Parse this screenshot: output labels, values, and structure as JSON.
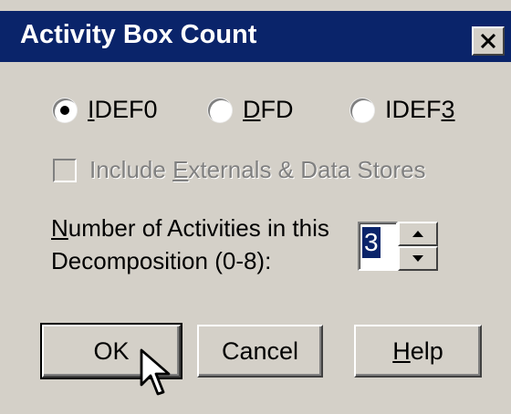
{
  "window": {
    "title": "Activity Box Count"
  },
  "diagram_type": {
    "options": [
      {
        "pre": "",
        "mnemonic": "I",
        "post": "DEF0",
        "selected": true
      },
      {
        "pre": "",
        "mnemonic": "D",
        "post": "FD",
        "selected": false
      },
      {
        "pre": "IDEF",
        "mnemonic": "3",
        "post": "",
        "selected": false
      }
    ]
  },
  "include_externals": {
    "pre": "Include ",
    "mnemonic": "E",
    "post": "xternals & Data Stores",
    "checked": false,
    "enabled": false
  },
  "activity_count": {
    "label_line1_mnemonic": "N",
    "label_line1_rest": "umber of Activities in this",
    "label_line2": "Decomposition (0-8):",
    "value": "3"
  },
  "buttons": {
    "ok_label": "OK",
    "cancel_label": "Cancel",
    "help_mnemonic": "H",
    "help_rest": "elp"
  },
  "colors": {
    "titlebar": "#0a246a",
    "dialog_face": "#d4d0c8",
    "selection": "#0a246a"
  }
}
